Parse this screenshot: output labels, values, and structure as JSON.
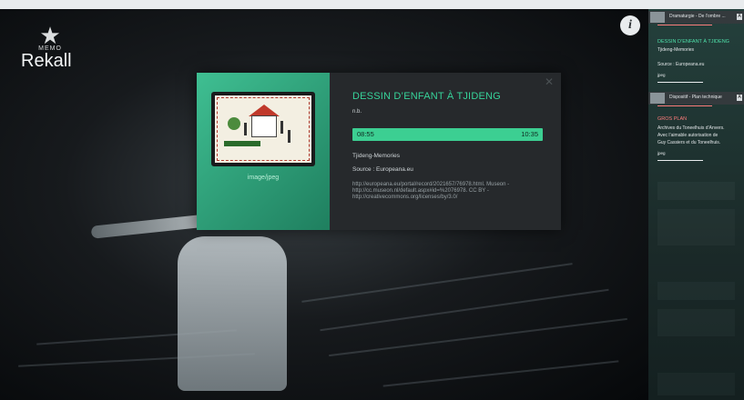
{
  "brand": {
    "small": "MEMO",
    "name": "Rekall",
    "icon": "star-icon"
  },
  "info_button": {
    "label": "i",
    "icon": "info-icon"
  },
  "modal": {
    "mime": "image/jpeg",
    "title": "DESSIN D’ENFANT À TJIDENG",
    "subtitle": "n.b.",
    "time_start": "08:55",
    "time_end": "10:35",
    "collection": "Tjideng-Memories",
    "source": "Source : Europeana.eu",
    "links": "http://europeana.eu/portal/record/2021657/76978.html. Museon - http://cc.museon.nl/default.aspx#id=%2076978. CC BY - http://creativecommons.org/licenses/by/3.0/"
  },
  "sidebar": {
    "items": [
      {
        "header": "Dramaturgie - De l’ombre ...",
        "icon_label": "A"
      },
      {
        "title": "DESSIN D’ENFANT À TJIDENG",
        "line1": "Tjideng-Memories",
        "line2": "Source : Europeana.eu",
        "mime": "jpeg"
      },
      {
        "header": "Dispositif - Plan technique",
        "icon_label": "A"
      },
      {
        "title": "GROS PLAN",
        "line1": "Archives du Toneelhuis d’Anvers.",
        "line2": "Avec l’aimable autorisation de",
        "line3": "Guy Cassiers et du Toneelhuis.",
        "mime": "jpeg"
      }
    ]
  },
  "colors": {
    "accent_green": "#3ccf92",
    "sidebar_red": "#ff7c7c",
    "modal_bg": "#26292c"
  }
}
